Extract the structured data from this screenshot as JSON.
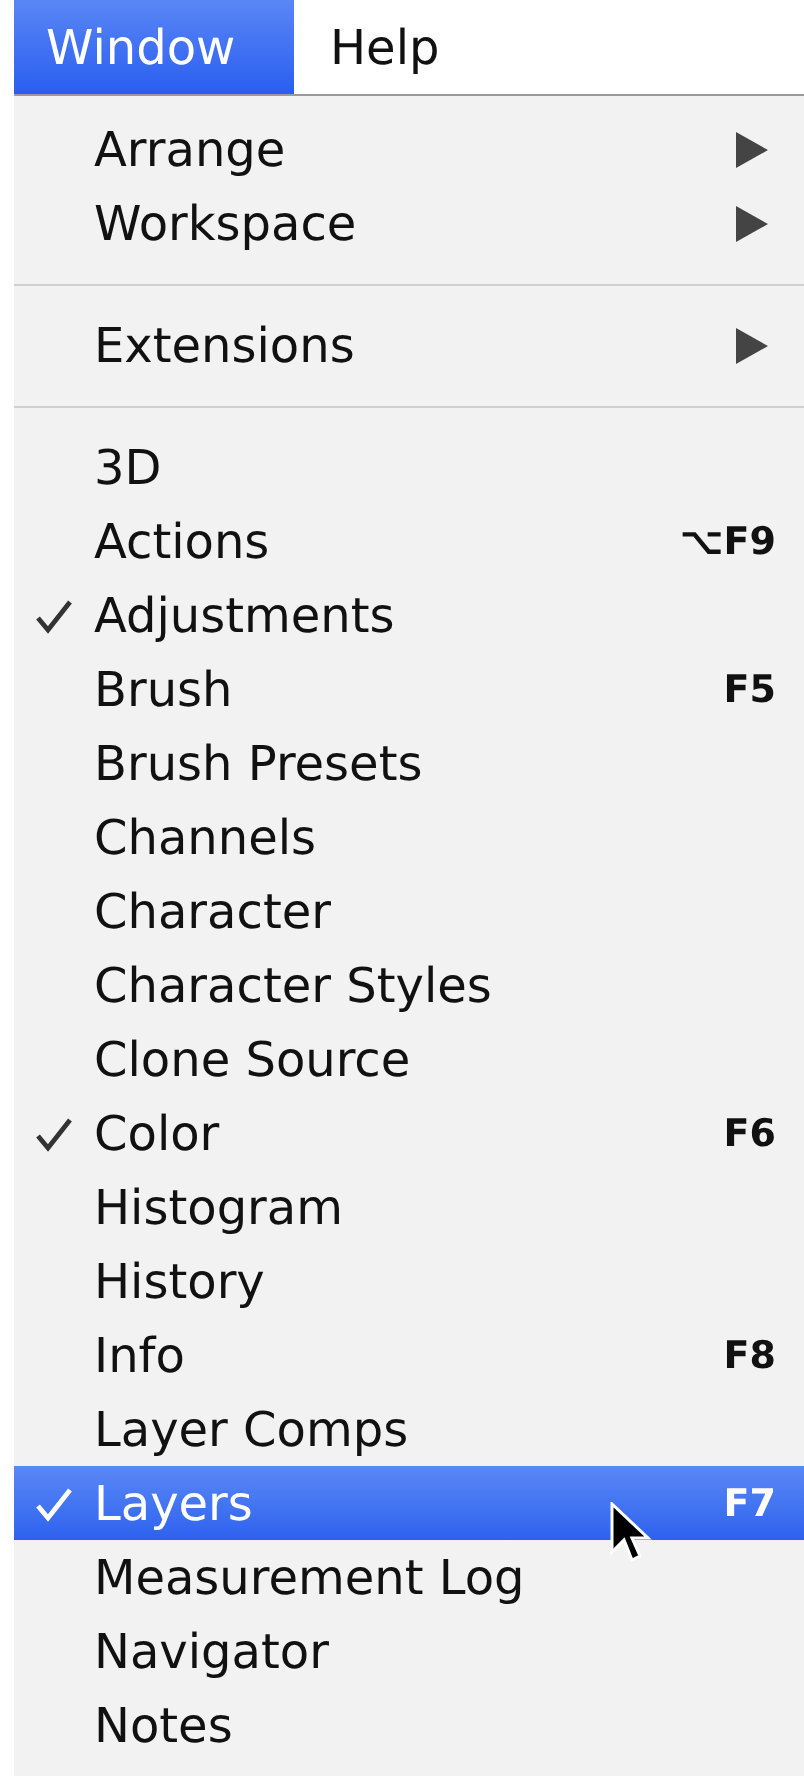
{
  "menubar": [
    {
      "label": "Window",
      "selected": true
    },
    {
      "label": "Help",
      "selected": false
    }
  ],
  "menu": {
    "sections": [
      {
        "items": [
          {
            "label": "Arrange",
            "kind": "submenu",
            "checked": false,
            "selected": false
          },
          {
            "label": "Workspace",
            "kind": "submenu",
            "checked": false,
            "selected": false
          }
        ]
      },
      {
        "items": [
          {
            "label": "Extensions",
            "kind": "submenu",
            "checked": false,
            "selected": false
          }
        ]
      },
      {
        "items": [
          {
            "label": "3D",
            "kind": "command",
            "checked": false,
            "selected": false
          },
          {
            "label": "Actions",
            "kind": "command",
            "checked": false,
            "selected": false,
            "shortcut": "⌥F9"
          },
          {
            "label": "Adjustments",
            "kind": "command",
            "checked": true,
            "selected": false
          },
          {
            "label": "Brush",
            "kind": "command",
            "checked": false,
            "selected": false,
            "shortcut": "F5"
          },
          {
            "label": "Brush Presets",
            "kind": "command",
            "checked": false,
            "selected": false
          },
          {
            "label": "Channels",
            "kind": "command",
            "checked": false,
            "selected": false
          },
          {
            "label": "Character",
            "kind": "command",
            "checked": false,
            "selected": false
          },
          {
            "label": "Character Styles",
            "kind": "command",
            "checked": false,
            "selected": false
          },
          {
            "label": "Clone Source",
            "kind": "command",
            "checked": false,
            "selected": false
          },
          {
            "label": "Color",
            "kind": "command",
            "checked": true,
            "selected": false,
            "shortcut": "F6"
          },
          {
            "label": "Histogram",
            "kind": "command",
            "checked": false,
            "selected": false
          },
          {
            "label": "History",
            "kind": "command",
            "checked": false,
            "selected": false
          },
          {
            "label": "Info",
            "kind": "command",
            "checked": false,
            "selected": false,
            "shortcut": "F8"
          },
          {
            "label": "Layer Comps",
            "kind": "command",
            "checked": false,
            "selected": false
          },
          {
            "label": "Layers",
            "kind": "command",
            "checked": true,
            "selected": true,
            "shortcut": "F7"
          },
          {
            "label": "Measurement Log",
            "kind": "command",
            "checked": false,
            "selected": false
          },
          {
            "label": "Navigator",
            "kind": "command",
            "checked": false,
            "selected": false
          },
          {
            "label": "Notes",
            "kind": "command",
            "checked": false,
            "selected": false
          }
        ]
      }
    ]
  }
}
